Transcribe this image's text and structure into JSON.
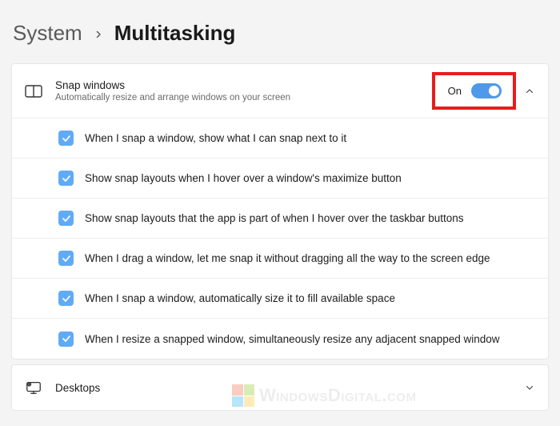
{
  "breadcrumb": {
    "parent": "System",
    "current": "Multitasking"
  },
  "snap": {
    "title": "Snap windows",
    "subtitle": "Automatically resize and arrange windows on your screen",
    "toggle_label": "On",
    "toggle_state": "on",
    "options": [
      {
        "label": "When I snap a window, show what I can snap next to it",
        "checked": true
      },
      {
        "label": "Show snap layouts when I hover over a window's maximize button",
        "checked": true
      },
      {
        "label": "Show snap layouts that the app is part of when I hover over the taskbar buttons",
        "checked": true
      },
      {
        "label": "When I drag a window, let me snap it without dragging all the way to the screen edge",
        "checked": true
      },
      {
        "label": "When I snap a window, automatically size it to fill available space",
        "checked": true
      },
      {
        "label": "When I resize a snapped window, simultaneously resize any adjacent snapped window",
        "checked": true
      }
    ]
  },
  "desktops": {
    "title": "Desktops"
  },
  "watermark": {
    "text": "WindowsDigital.com"
  }
}
